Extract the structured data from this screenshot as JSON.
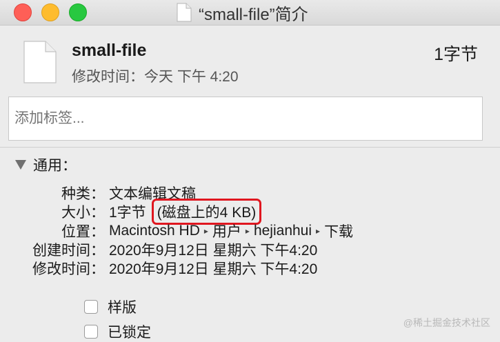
{
  "window": {
    "title": "“small-file”简介"
  },
  "header": {
    "file_name": "small-file",
    "modified": "修改时间：今天 下午 4:20",
    "size": "1字节"
  },
  "tags": {
    "placeholder": "添加标签..."
  },
  "general": {
    "label": "通用：",
    "rows": {
      "kind": {
        "label": "种类：",
        "value": "文本编辑文稿"
      },
      "size": {
        "label": "大小：",
        "value": "1字节",
        "disk": "(磁盘上的4 KB)"
      },
      "location": {
        "label": "位置：",
        "path": [
          "Macintosh HD",
          "用户",
          "hejianhui",
          "下载"
        ]
      },
      "created": {
        "label": "创建时间：",
        "value": "2020年9月12日 星期六 下午4:20"
      },
      "modified": {
        "label": "修改时间：",
        "value": "2020年9月12日 星期六 下午4:20"
      }
    }
  },
  "options": {
    "stationery": {
      "label": "样版",
      "checked": false
    },
    "locked": {
      "label": "已锁定",
      "checked": false
    }
  },
  "watermark": "@稀土掘金技术社区",
  "icons": {
    "close": "close-icon",
    "minimize": "minimize-icon",
    "maximize": "maximize-icon",
    "document": "document-icon",
    "disclosure": "disclosure-triangle-icon",
    "path_separator": "path-arrow-icon"
  },
  "colors": {
    "close": "#fe5f57",
    "minimize": "#febc2e",
    "maximize": "#28c840",
    "highlight": "#e0161f"
  }
}
